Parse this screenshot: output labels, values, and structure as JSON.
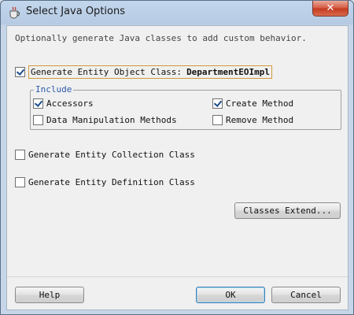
{
  "window": {
    "title": "Select Java Options",
    "close_label": "✕"
  },
  "description": "Optionally generate Java classes to add custom behavior.",
  "entity_object": {
    "label": "Generate Entity Object Class:",
    "class_name": "DepartmentEOImpl",
    "checked": true
  },
  "include": {
    "label": "Include",
    "accessors": {
      "label": "Accessors",
      "checked": true
    },
    "create_method": {
      "label": "Create Method",
      "checked": true
    },
    "data_manipulation": {
      "label": "Data Manipulation Methods",
      "checked": false
    },
    "remove_method": {
      "label": "Remove Method",
      "checked": false
    }
  },
  "entity_collection": {
    "label": "Generate Entity Collection Class",
    "checked": false
  },
  "entity_definition": {
    "label": "Generate Entity Definition Class",
    "checked": false
  },
  "buttons": {
    "classes_extend": "Classes Extend...",
    "help": "Help",
    "ok": "OK",
    "cancel": "Cancel"
  }
}
